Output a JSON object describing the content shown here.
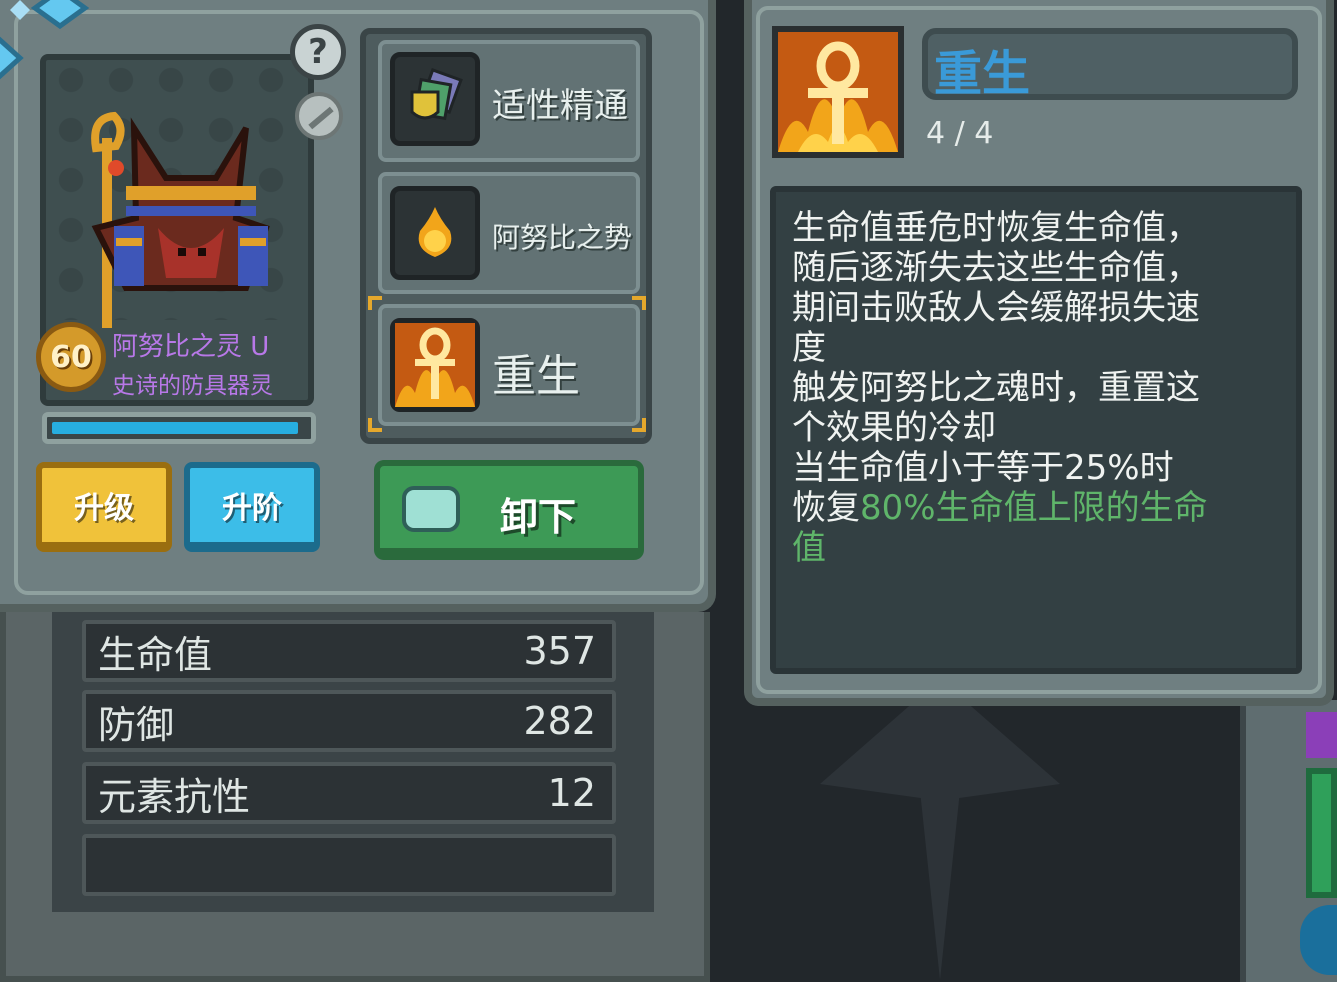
{
  "hero": {
    "level": "60",
    "name": "阿努比之灵 U",
    "rarity": "史诗的防具器灵",
    "xp_fraction": 0.97
  },
  "buttons": {
    "upgrade": "升级",
    "ascend": "升阶",
    "unequip": "卸下",
    "help": "?"
  },
  "skills": [
    {
      "label": "适性精通",
      "icon": "shield-stack-icon"
    },
    {
      "label": "阿努比之势",
      "icon": "fire-orb-icon"
    },
    {
      "label": "重生",
      "icon": "ankh-icon",
      "selected": true
    }
  ],
  "stats": [
    {
      "label": "生命值",
      "value": "357"
    },
    {
      "label": "防御",
      "value": "282"
    },
    {
      "label": "元素抗性",
      "value": "12"
    }
  ],
  "detail": {
    "title": "重生",
    "level": "4 / 4",
    "lines": [
      "生命值垂危时恢复生命值，",
      "随后逐渐失去这些生命值，",
      "期间击败敌人会缓解损失速",
      "度",
      "触发阿努比之魂时，重置这",
      "个效果的冷却",
      "当生命值小于等于25%时"
    ],
    "last_prefix": "恢复",
    "last_highlight": "80%生命值上限的生命",
    "last_tail": "值"
  },
  "colors": {
    "accent_blue": "#3a9ad8",
    "highlight_green": "#5fb56a",
    "rarity_purple": "#b878e8",
    "upgrade_yellow": "#f0c23a",
    "ascend_blue": "#3cbde8",
    "unequip_green": "#3d9a56"
  }
}
